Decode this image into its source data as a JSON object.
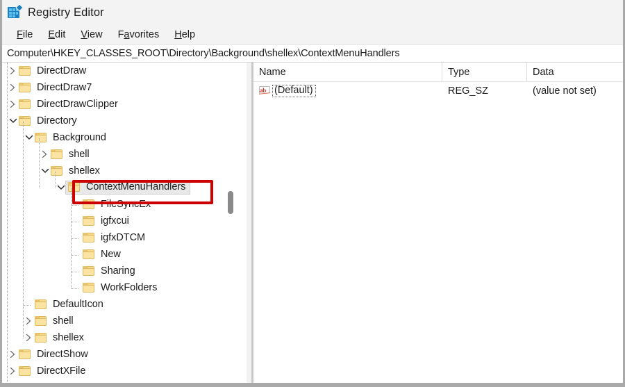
{
  "window": {
    "title": "Registry Editor",
    "icon": "registry-editor-icon"
  },
  "menu": {
    "items": [
      {
        "accel": "F",
        "rest": "ile"
      },
      {
        "accel": "E",
        "rest": "dit"
      },
      {
        "accel": "V",
        "rest": "iew"
      },
      {
        "pre": "F",
        "accel": "a",
        "rest": "vorites"
      },
      {
        "accel": "H",
        "rest": "elp"
      }
    ],
    "labels": [
      "File",
      "Edit",
      "View",
      "Favorites",
      "Help"
    ]
  },
  "address": {
    "path": "Computer\\HKEY_CLASSES_ROOT\\Directory\\Background\\shellex\\ContextMenuHandlers"
  },
  "tree": {
    "items": [
      {
        "label": "DirectDraw",
        "depth": 0,
        "state": "collapsed",
        "selected": false
      },
      {
        "label": "DirectDraw7",
        "depth": 0,
        "state": "collapsed",
        "selected": false
      },
      {
        "label": "DirectDrawClipper",
        "depth": 0,
        "state": "collapsed",
        "selected": false
      },
      {
        "label": "Directory",
        "depth": 0,
        "state": "expanded",
        "selected": false
      },
      {
        "label": "Background",
        "depth": 1,
        "state": "expanded",
        "selected": false
      },
      {
        "label": "shell",
        "depth": 2,
        "state": "collapsed",
        "selected": false
      },
      {
        "label": "shellex",
        "depth": 2,
        "state": "expanded",
        "selected": false
      },
      {
        "label": "ContextMenuHandlers",
        "depth": 3,
        "state": "expanded",
        "selected": true
      },
      {
        "label": "FileSyncEx",
        "depth": 4,
        "state": "leaf",
        "selected": false
      },
      {
        "label": "igfxcui",
        "depth": 4,
        "state": "leaf",
        "selected": false
      },
      {
        "label": "igfxDTCM",
        "depth": 4,
        "state": "leaf",
        "selected": false
      },
      {
        "label": "New",
        "depth": 4,
        "state": "leaf",
        "selected": false
      },
      {
        "label": "Sharing",
        "depth": 4,
        "state": "leaf",
        "selected": false
      },
      {
        "label": "WorkFolders",
        "depth": 4,
        "state": "leaf",
        "selected": false
      },
      {
        "label": "DefaultIcon",
        "depth": 1,
        "state": "leaf",
        "selected": false
      },
      {
        "label": "shell",
        "depth": 1,
        "state": "collapsed",
        "selected": false
      },
      {
        "label": "shellex",
        "depth": 1,
        "state": "collapsed",
        "selected": false
      },
      {
        "label": "DirectShow",
        "depth": 0,
        "state": "collapsed",
        "selected": false
      },
      {
        "label": "DirectXFile",
        "depth": 0,
        "state": "collapsed",
        "selected": false
      }
    ]
  },
  "list": {
    "columns": [
      "Name",
      "Type",
      "Data"
    ],
    "rows": [
      {
        "icon": "string-value-icon",
        "name": "(Default)",
        "type": "REG_SZ",
        "data": "(value not set)"
      }
    ]
  },
  "annotation": {
    "color": "#cc0000",
    "target": "ContextMenuHandlers"
  },
  "colors": {
    "accent": "#1a7fc1",
    "folder": "#fbe3a2",
    "annotation": "#cc0000",
    "selection": "#e8e8e8"
  }
}
